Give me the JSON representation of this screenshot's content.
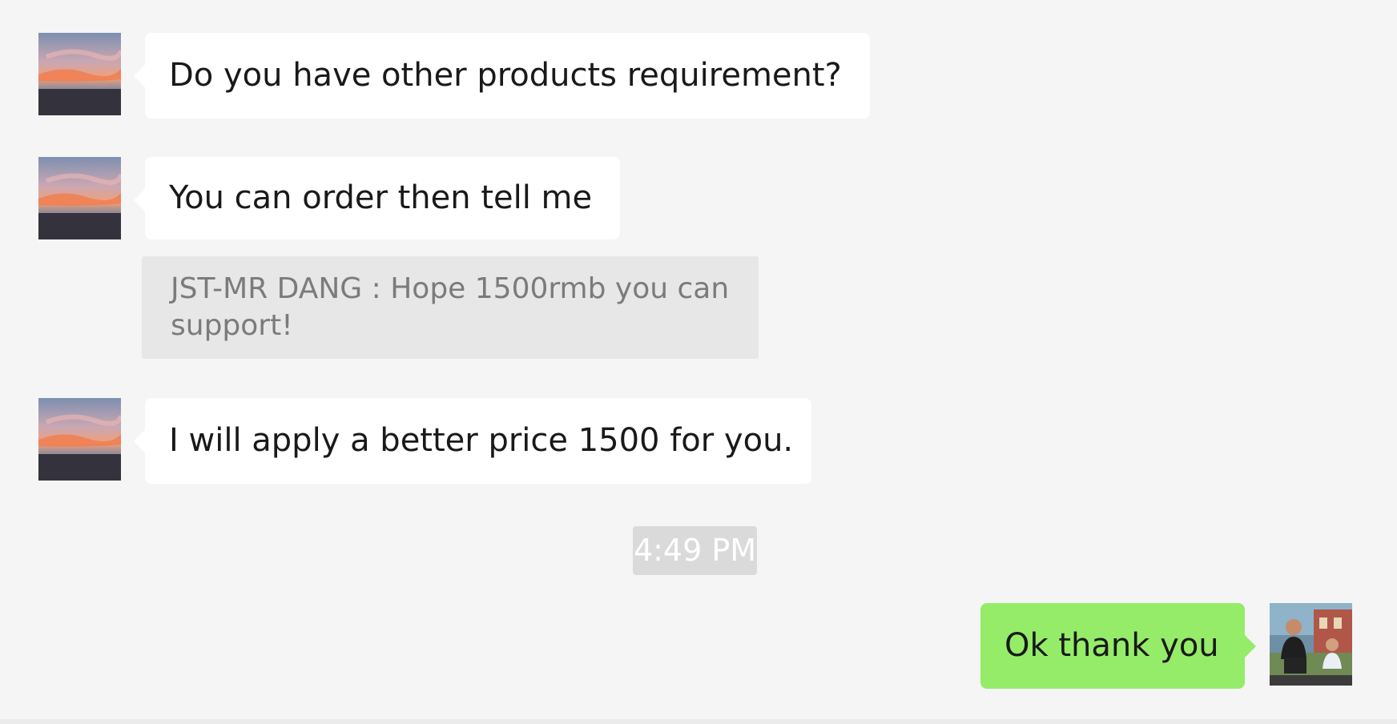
{
  "messages": [
    {
      "direction": "incoming",
      "avatar_icon": "sunset-avatar",
      "text": "Do you have other products requirement?"
    },
    {
      "direction": "incoming",
      "avatar_icon": "sunset-avatar",
      "text": "You can order then tell me"
    },
    {
      "direction": "incoming",
      "avatar_icon": "sunset-avatar",
      "text": "I will apply a better price 1500 for you."
    },
    {
      "direction": "outgoing",
      "avatar_icon": "family-photo-avatar",
      "text": "Ok thank you"
    }
  ],
  "quote": {
    "text": "JST-MR DANG : Hope 1500rmb you can support!"
  },
  "timestamp": "4:49 PM",
  "colors": {
    "background": "#f5f5f5",
    "incoming_bubble": "#ffffff",
    "outgoing_bubble": "#95ec69",
    "quote_background": "#e7e7e7",
    "timestamp_background": "#dadada"
  }
}
